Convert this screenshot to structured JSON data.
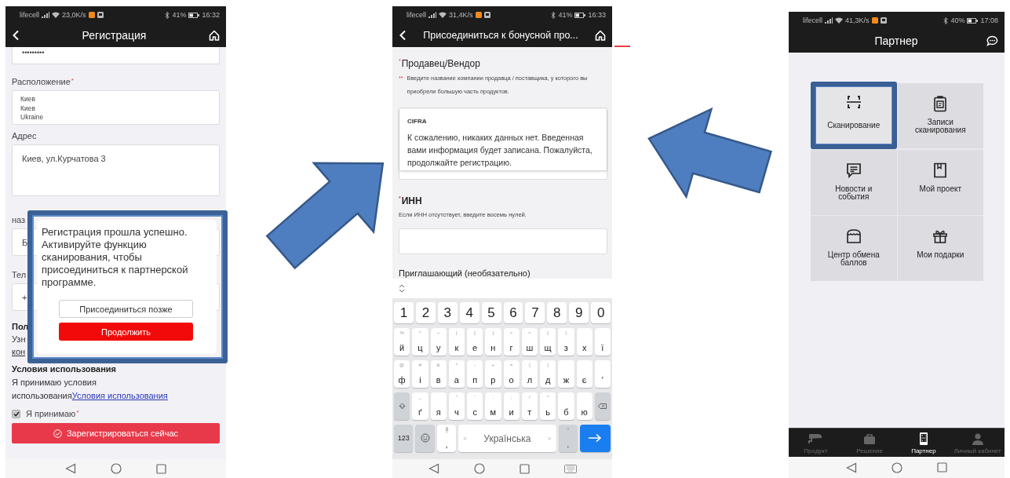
{
  "screens": [
    {
      "kind": "registration",
      "status_bar": {
        "carrier": "lifecell",
        "speed": "23,0K/s",
        "battery": "41%",
        "time": "16:32"
      },
      "header": {
        "back": true,
        "title": "Регистрация"
      },
      "fields": [
        {
          "kind": "password",
          "value": "•••••••••"
        },
        {
          "kind": "textarea",
          "label": "Расположение",
          "mark": "*",
          "lines": [
            "Киев",
            "Киев",
            "Ukraine"
          ]
        },
        {
          "kind": "textarea",
          "label": "Адрес",
          "lines": [
            "Киев, ул.Курчатова 3"
          ]
        },
        {
          "kind": "input",
          "label": "наз",
          "value": "Б"
        },
        {
          "kind": "input",
          "label": "Тел",
          "value": "+"
        }
      ],
      "privacy": {
        "title": "Пол",
        "text": "Узн",
        "link": "кон"
      },
      "terms": {
        "title": "Условия использования",
        "text": "Я принимаю условия использования",
        "link": "Условия использования"
      },
      "accept": {
        "label": "Я принимаю",
        "mark": "*",
        "checked": true
      },
      "submit_button": "Зарегистрироваться сейчас",
      "dialog": {
        "message": "Регистрация прошла успешно. Активируйте функцию сканирования, чтобы присоединиться к партнерской программе.",
        "buttons": [
          {
            "label": "Присоединиться позже",
            "kind": "secondary"
          },
          {
            "label": "Продолжить",
            "kind": "primary"
          }
        ]
      }
    },
    {
      "kind": "bonus",
      "status_bar": {
        "carrier": "lifecell",
        "speed": "31,4K/s",
        "battery": "41%",
        "time": "16:33"
      },
      "header": {
        "back": true,
        "title": "Присоединиться к бонусной про..."
      },
      "vendor": {
        "label": "Продавец/Вендор",
        "mark": "*",
        "hint_mark": "**",
        "hint": "Введите название компании продавца / поставщика, у которого вы приобрели большую часть продуктов.",
        "suggestion": "CIFRA",
        "message": "К сожалению, никаких данных нет. Введенная вами информация будет записана. Пожалуйста, продолжайте регистрацию."
      },
      "inn": {
        "label": "ИНН",
        "mark": "*",
        "hint": "Если ИНН отсутствует, введите восемь нулей."
      },
      "referrer": {
        "label": "Приглашающий (необязательно)"
      },
      "keyboard": {
        "number_row": [
          {
            "kind": "number",
            "label": "1"
          },
          {
            "kind": "number",
            "label": "2"
          },
          {
            "kind": "number",
            "label": "3"
          },
          {
            "kind": "number",
            "label": "4"
          },
          {
            "kind": "number",
            "label": "5"
          },
          {
            "kind": "number",
            "label": "6"
          },
          {
            "kind": "number",
            "label": "7"
          },
          {
            "kind": "number",
            "label": "8"
          },
          {
            "kind": "number",
            "label": "9"
          },
          {
            "kind": "number",
            "label": "0"
          }
        ],
        "letter_rows": [
          [
            {
              "kind": "char",
              "label": "й",
              "hint": "%"
            },
            {
              "kind": "char",
              "label": "ц",
              "hint": "^"
            },
            {
              "kind": "char",
              "label": "у",
              "hint": "~"
            },
            {
              "kind": "char",
              "label": "к",
              "hint": "|"
            },
            {
              "kind": "char",
              "label": "е",
              "hint": "["
            },
            {
              "kind": "char",
              "label": "н",
              "hint": "]"
            },
            {
              "kind": "char",
              "label": "г",
              "hint": "<"
            },
            {
              "kind": "char",
              "label": "ш",
              "hint": ">"
            },
            {
              "kind": "char",
              "label": "щ",
              "hint": "{"
            },
            {
              "kind": "char",
              "label": "з",
              "hint": "}"
            },
            {
              "kind": "char",
              "label": "х"
            },
            {
              "kind": "char",
              "label": "ї"
            }
          ],
          [
            {
              "kind": "char",
              "label": "ф",
              "hint": "@"
            },
            {
              "kind": "char",
              "label": "і",
              "hint": "#"
            },
            {
              "kind": "char",
              "label": "в",
              "hint": "&"
            },
            {
              "kind": "char",
              "label": "а",
              "hint": "*"
            },
            {
              "kind": "char",
              "label": "п",
              "hint": "-"
            },
            {
              "kind": "char",
              "label": "р",
              "hint": "+"
            },
            {
              "kind": "char",
              "label": "о",
              "hint": "="
            },
            {
              "kind": "char",
              "label": "л",
              "hint": "("
            },
            {
              "kind": "char",
              "label": "д",
              "hint": ")"
            },
            {
              "kind": "char",
              "label": "ж"
            },
            {
              "kind": "char",
              "label": "є"
            },
            {
              "kind": "char",
              "label": "'"
            }
          ],
          [
            {
              "kind": "shift"
            },
            {
              "kind": "char",
              "label": "ґ",
              "hint": "_"
            },
            {
              "kind": "char",
              "label": "я"
            },
            {
              "kind": "char",
              "label": "ч",
              "hint": "\""
            },
            {
              "kind": "char",
              "label": "с",
              "hint": "'"
            },
            {
              "kind": "char",
              "label": "м",
              "hint": ":"
            },
            {
              "kind": "char",
              "label": "и",
              "hint": ";"
            },
            {
              "kind": "char",
              "label": "т",
              "hint": "/"
            },
            {
              "kind": "char",
              "label": "ь",
              "hint": "^"
            },
            {
              "kind": "char",
              "label": "б"
            },
            {
              "kind": "char",
              "label": "ю"
            },
            {
              "kind": "backspace"
            }
          ]
        ],
        "bottom_row": [
          {
            "kind": "mode",
            "label": "123"
          },
          {
            "kind": "emoji"
          },
          {
            "kind": "comma",
            "label": ","
          },
          {
            "kind": "space",
            "label": "Українська",
            "prev": "<",
            "next": ">"
          },
          {
            "kind": "period",
            "label": ".",
            "hint": "?"
          },
          {
            "kind": "enter"
          }
        ]
      }
    },
    {
      "kind": "partner",
      "status_bar": {
        "carrier": "lifecell",
        "speed": "41,3K/s",
        "battery": "40%",
        "time": "17:08"
      },
      "header": {
        "back": false,
        "title": "Партнер"
      },
      "tiles": [
        {
          "kind": "scan",
          "label": "Сканирование",
          "selected": true
        },
        {
          "kind": "records",
          "label": "Записи сканирования",
          "selected": false
        },
        {
          "kind": "news",
          "label": "Новости и события",
          "selected": false
        },
        {
          "kind": "project",
          "label": "Мой проект",
          "selected": false
        },
        {
          "kind": "store",
          "label": "Центр обмена баллов",
          "selected": false
        },
        {
          "kind": "gift",
          "label": "Мои подарки",
          "selected": false
        }
      ],
      "tabs": [
        {
          "kind": "camera",
          "label": "Продукт",
          "selected": false
        },
        {
          "kind": "briefcase",
          "label": "Решение",
          "selected": false
        },
        {
          "kind": "phone",
          "label": "Партнер",
          "selected": true
        },
        {
          "kind": "person",
          "label": "Личный кабинет",
          "selected": false
        }
      ]
    }
  ]
}
